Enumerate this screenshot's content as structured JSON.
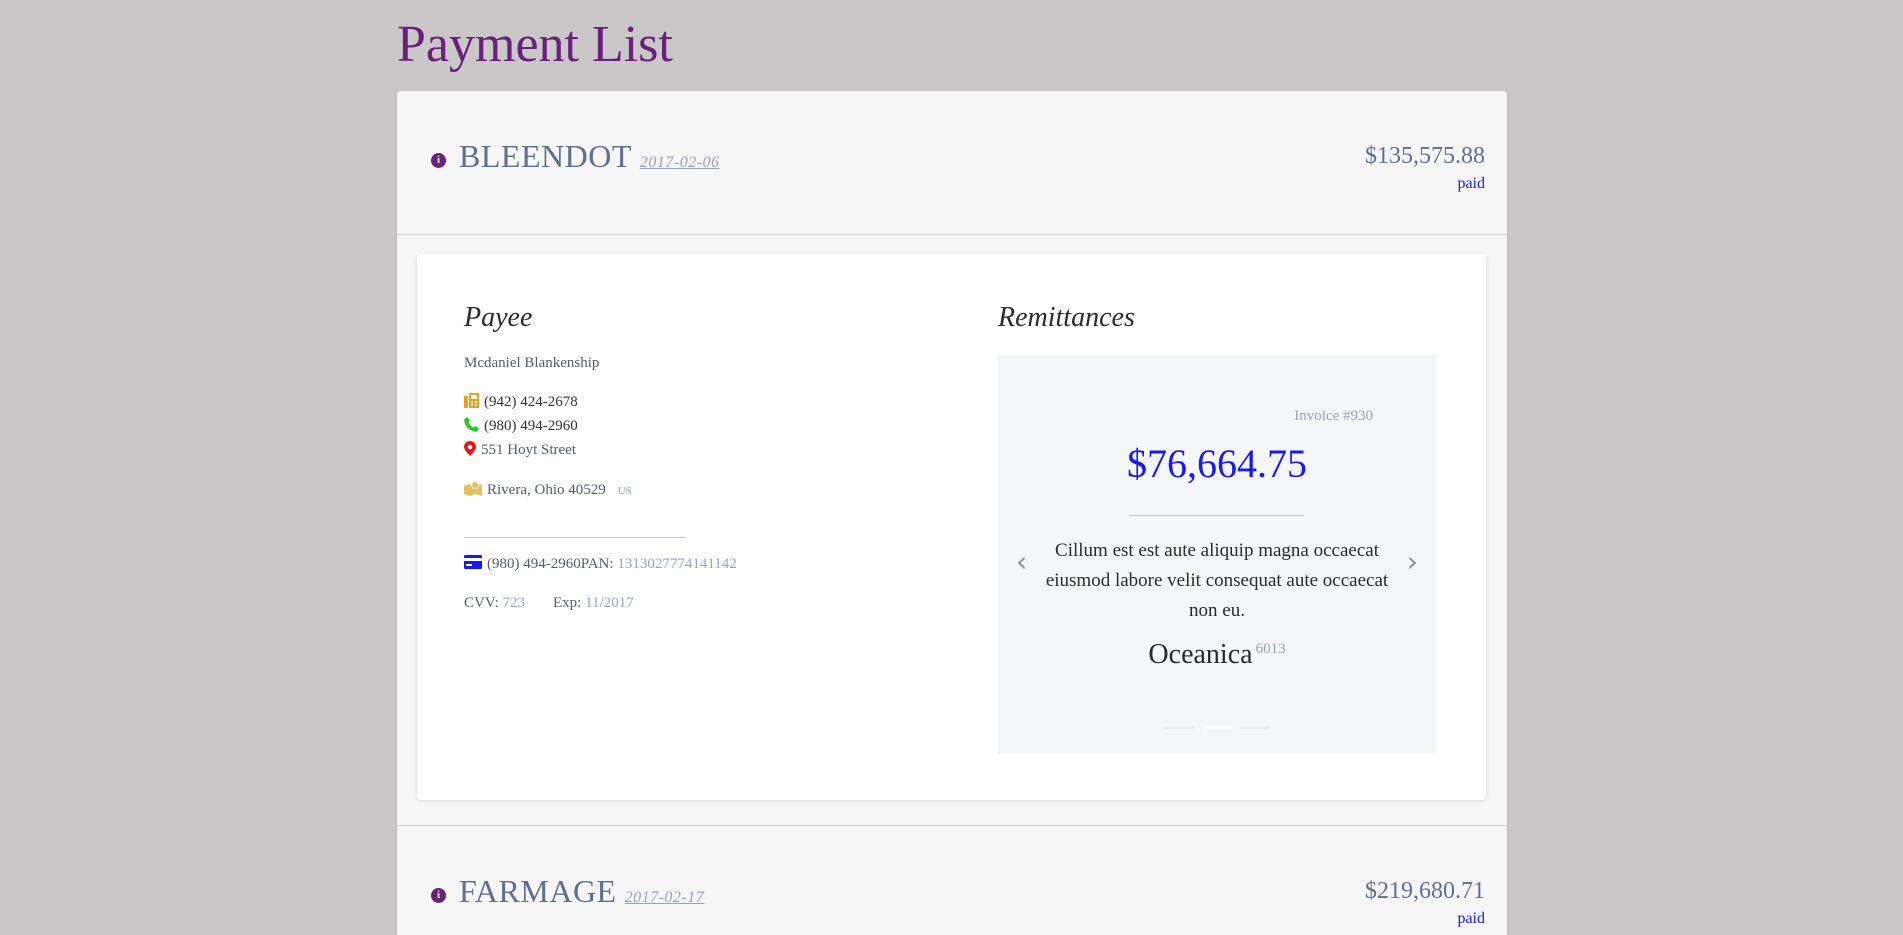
{
  "page_title": "Payment List",
  "payments": [
    {
      "company": "BLEENDOT",
      "date": "2017-02-06",
      "amount": "$135,575.88",
      "status": "paid",
      "payee": {
        "section_title": "Payee",
        "name": "Mcdaniel Blankenship",
        "fax": "(942) 424-2678",
        "phone": "(980) 494-2960",
        "address": "551 Hoyt Street",
        "city": "Rivera, Ohio 40529",
        "country": "US",
        "card_phone": "(980) 494-2960",
        "pan_label": "PAN:",
        "pan": "1313027774141142",
        "cvv_label": "CVV:",
        "cvv": "723",
        "exp_label": "Exp:",
        "exp": "11/2017"
      },
      "remittances": {
        "section_title": "Remittances",
        "invoice": "Invoice #930",
        "amount": "$76,664.75",
        "description": "Cillum est est aute aliquip magna occaecat eiusmod labore velit consequat aute occaecat non eu.",
        "company": "Oceanica",
        "code": "6013",
        "slide_count": 3,
        "active_slide": 2
      }
    },
    {
      "company": "FARMAGE",
      "date": "2017-02-17",
      "amount": "$219,680.71",
      "status": "paid"
    }
  ],
  "icons": {
    "info": "info-icon",
    "fax": "fax-icon",
    "phone": "phone-icon",
    "address": "map-marker-icon",
    "city": "map-icon",
    "card": "credit-card-icon",
    "prev": "chevron-left-icon",
    "next": "chevron-right-icon"
  },
  "colors": {
    "title": "#6b1f7c",
    "accent_blue": "#1a1af0",
    "muted": "#9aa4b8",
    "fax_icon": "#f0a020",
    "phone_icon": "#22cc22",
    "marker_icon": "#ee1111",
    "map_icon": "#e8c060",
    "card_icon": "#1a1af0"
  }
}
